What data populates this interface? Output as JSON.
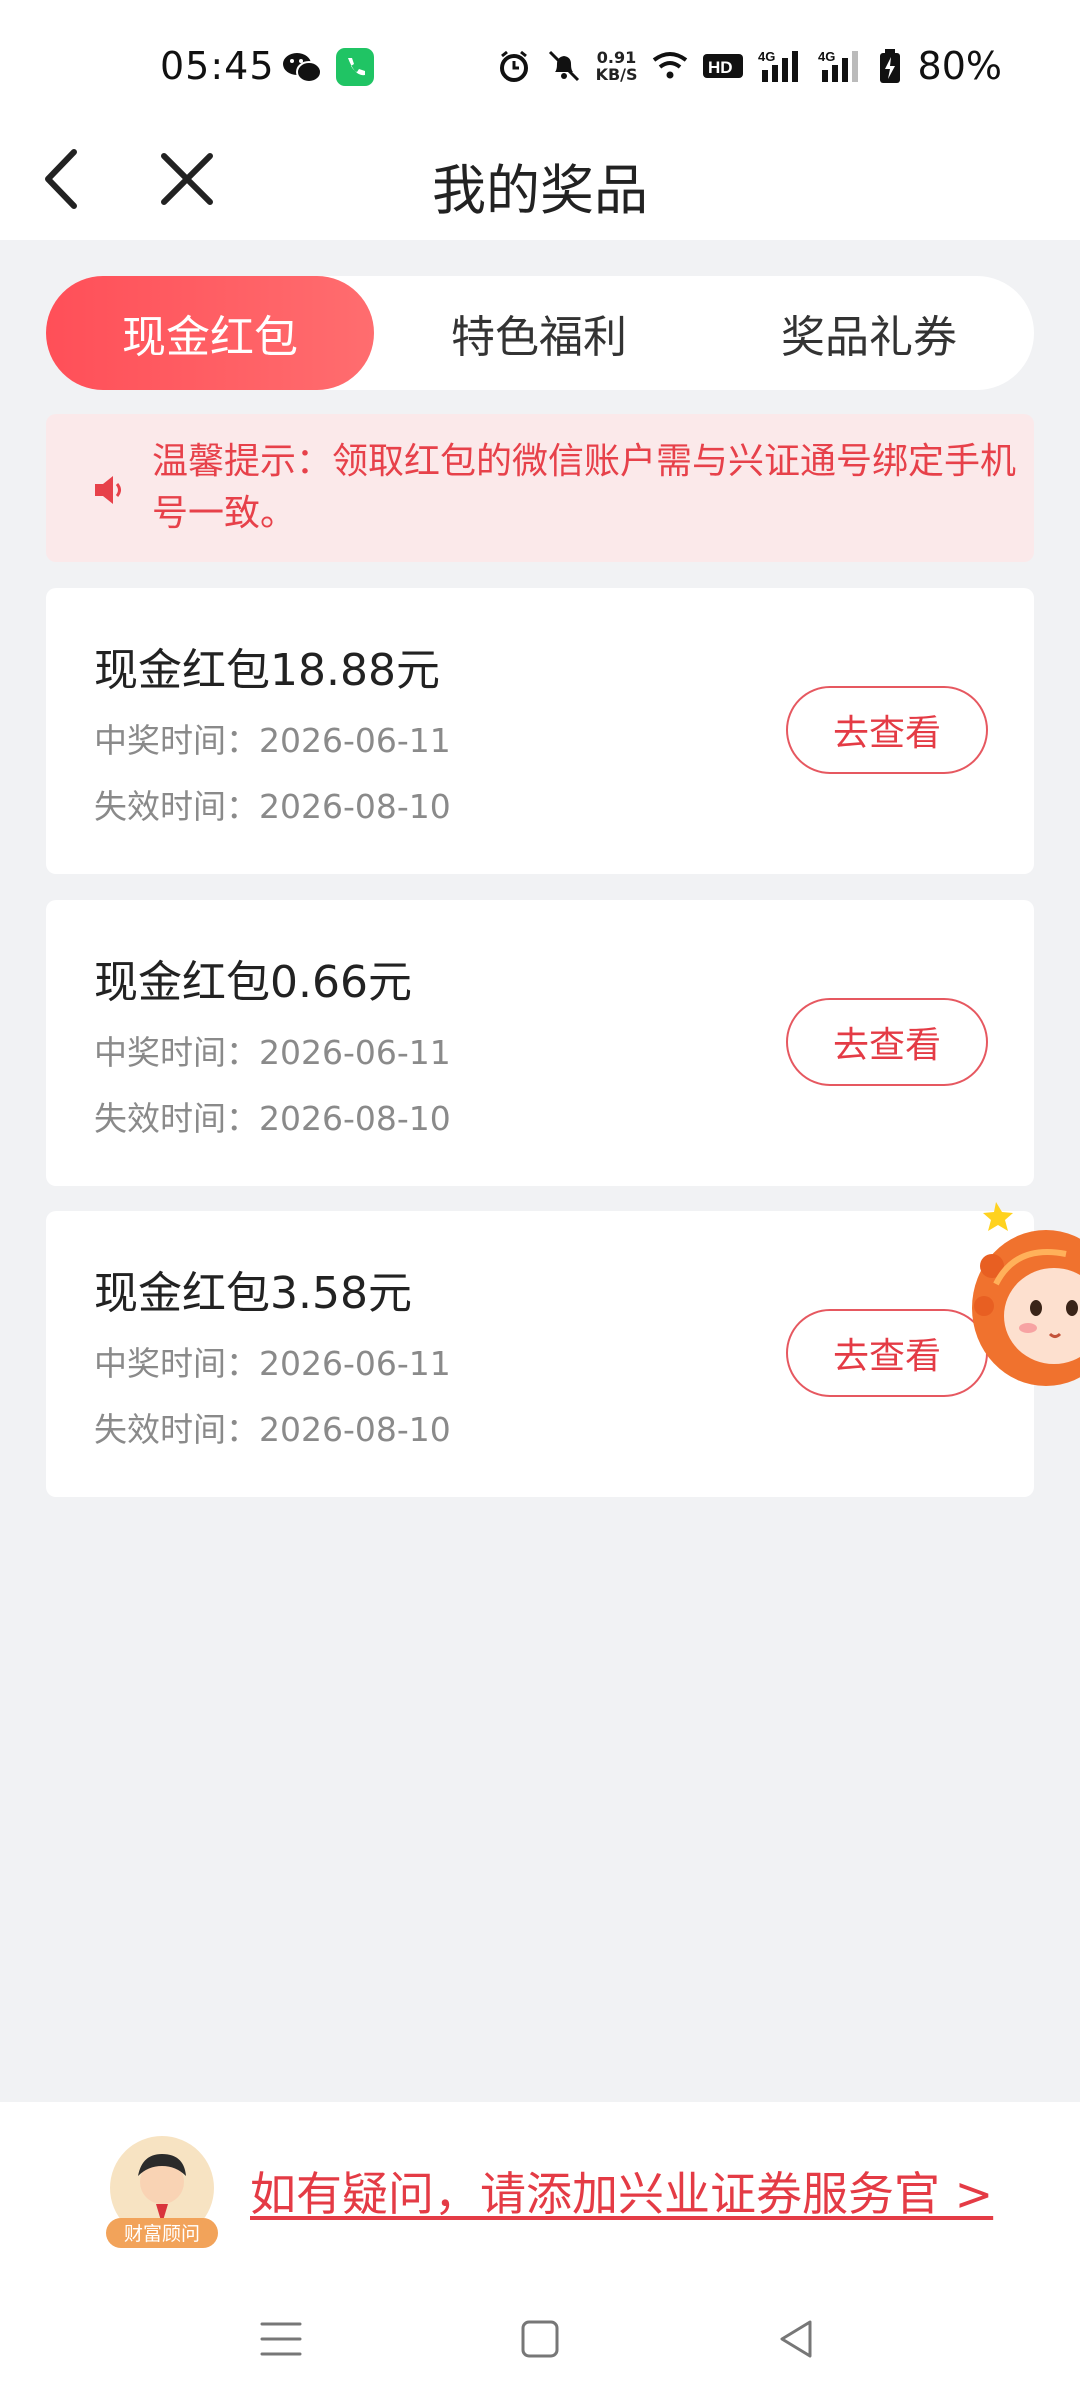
{
  "status_bar": {
    "time": "05:45",
    "net_speed_value": "0.91",
    "net_speed_unit": "KB/S",
    "hd_label": "HD",
    "signal1_label": "4G",
    "signal2_label": "4G",
    "battery": "80%"
  },
  "header": {
    "title": "我的奖品"
  },
  "tabs": [
    {
      "label": "现金红包",
      "active": true
    },
    {
      "label": "特色福利",
      "active": false
    },
    {
      "label": "奖品礼券",
      "active": false
    }
  ],
  "notice": {
    "text": "温馨提示：领取红包的微信账户需与兴证通号绑定手机号一致。"
  },
  "prizes": [
    {
      "title": "现金红包18.88元",
      "win_time": "中奖时间：2026-06-11",
      "expire_time": "失效时间：2026-08-10",
      "button": "去查看"
    },
    {
      "title": "现金红包0.66元",
      "win_time": "中奖时间：2026-06-11",
      "expire_time": "失效时间：2026-08-10",
      "button": "去查看"
    },
    {
      "title": "现金红包3.58元",
      "win_time": "中奖时间：2026-06-11",
      "expire_time": "失效时间：2026-08-10",
      "button": "去查看"
    }
  ],
  "advisor": {
    "badge": "财富顾问",
    "link_text": "如有疑问，请添加兴业证券服务官 >"
  },
  "colors": {
    "accent": "#e43b45",
    "tab_gradient_start": "#ff4f58",
    "notice_bg": "#fbe9ea",
    "page_bg": "#f1f2f4"
  },
  "icons": {
    "back": "back-arrow-icon",
    "close": "close-icon",
    "speaker": "speaker-icon",
    "menu": "menu-icon",
    "home": "home-icon",
    "back_nav": "nav-back-icon"
  }
}
